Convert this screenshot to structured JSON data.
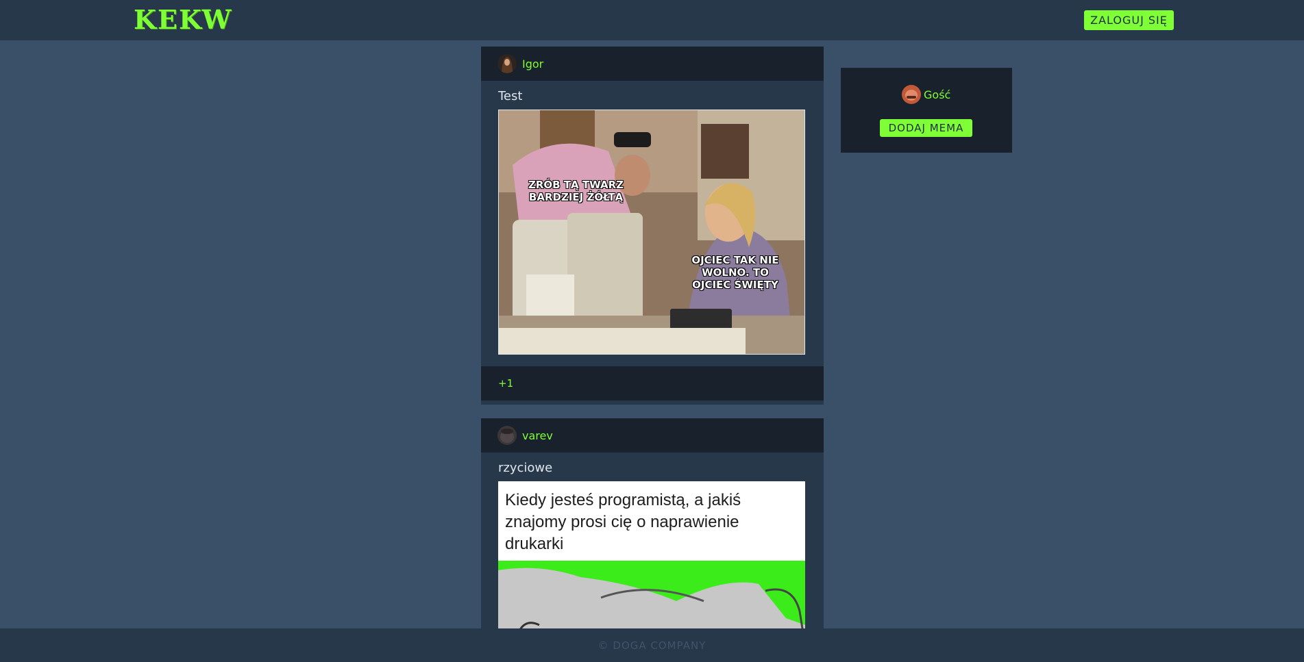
{
  "header": {
    "logo": "KEKW",
    "login_label": "ZALOGUJ SIĘ"
  },
  "posts": [
    {
      "author": "Igor",
      "title": "Test",
      "image_captions": [
        "ZRÓB TĄ TWARZ BARDZIEJ ŻÓŁTĄ",
        "OJCIEC TAK NIE WOLNO. TO OJCIEC ŚWIĘTY"
      ],
      "votes": "+1"
    },
    {
      "author": "varev",
      "title": "rzyciowe",
      "image_text": "Kiedy jesteś programistą, a jakiś znajomy prosi cię o naprawienie drukarki"
    }
  ],
  "sidebar": {
    "username": "Gość",
    "add_meme_label": "DODAJ MEMA"
  },
  "footer": {
    "copyright": "© DOGA COMPANY"
  },
  "colors": {
    "accent": "#7fff35",
    "background": "#3a5068",
    "panel": "#27384b",
    "panel_dark": "#18212c"
  }
}
